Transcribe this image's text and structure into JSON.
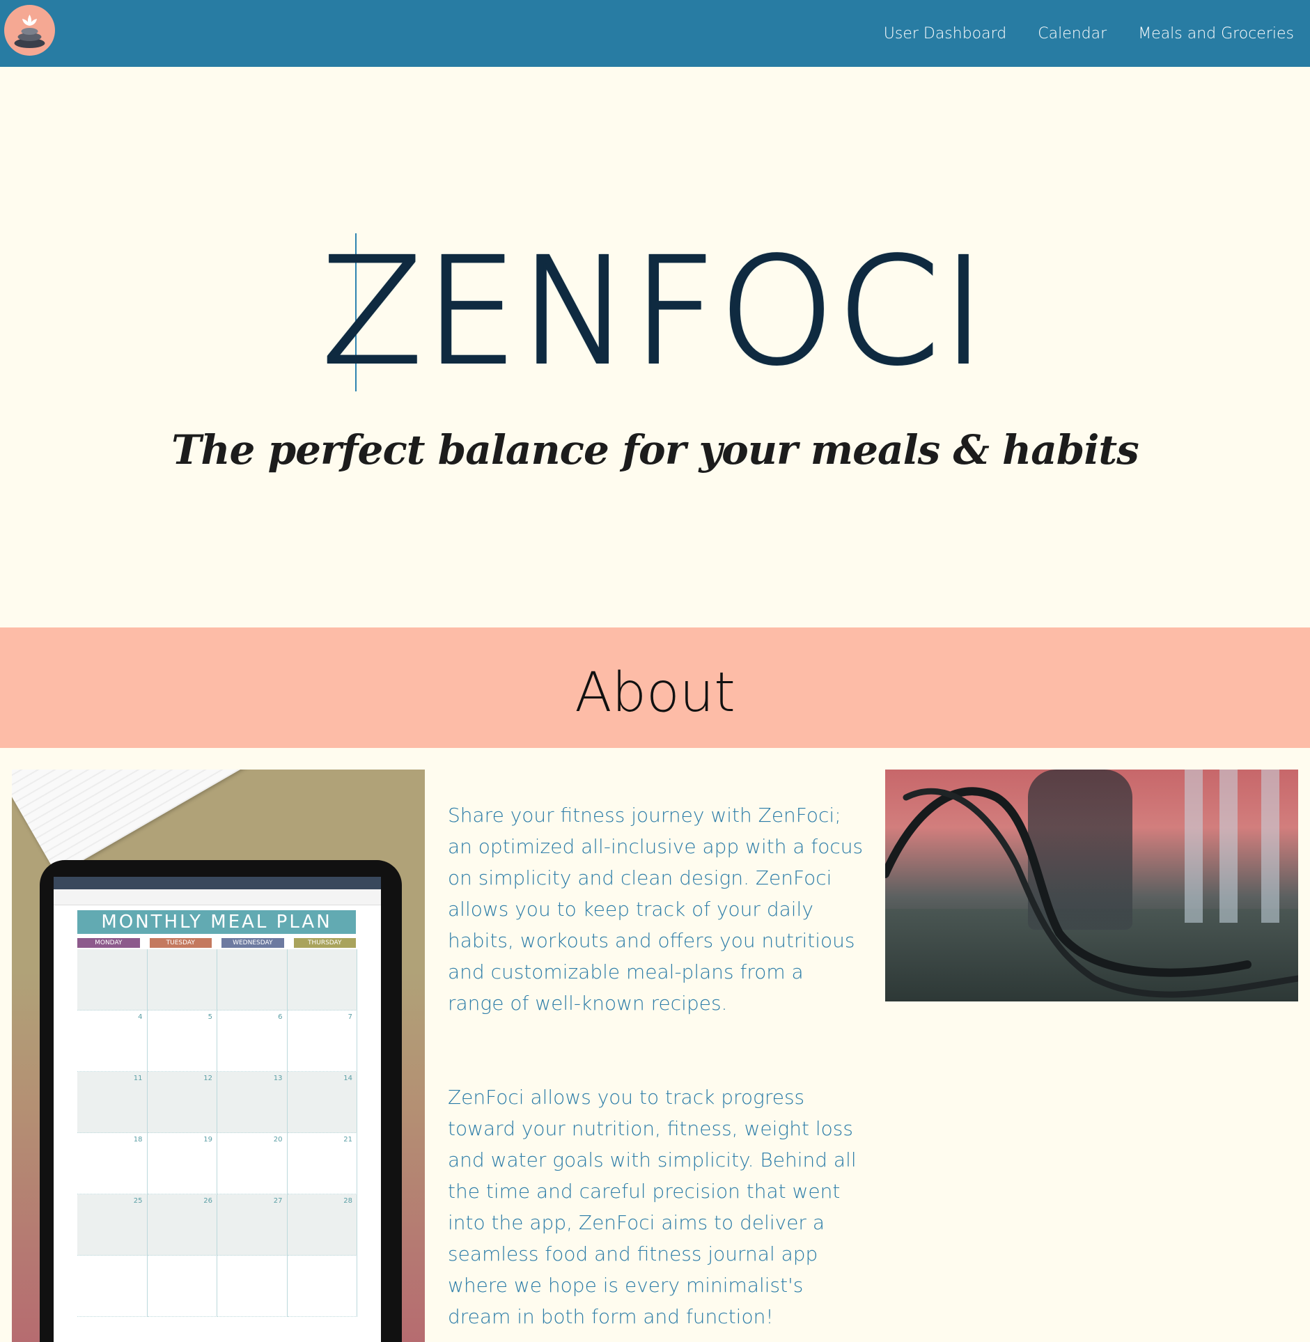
{
  "nav": {
    "logo": "lotus-stone-logo",
    "links": [
      "User Dashboard",
      "Calendar",
      "Meals and Groceries"
    ]
  },
  "hero": {
    "title": "ZENFOCI",
    "tagline": "The perfect balance for your meals & habits"
  },
  "about": {
    "heading": "About",
    "paragraph1": "Share your fitness journey with ZenFoci; an optimized all-inclusive app with a focus on simplicity and clean design. ZenFoci allows you to keep track of your daily habits, workouts and offers you nutritious and customizable meal-plans from a range of well-known recipes.",
    "paragraph2": "ZenFoci allows you to track progress toward your nutrition, fitness, weight loss and water goals with simplicity. Behind all the time and careful precision that went into the app, ZenFoci aims to deliver a seamless food and fitness journal app where we hope is every minimalist's dream in both form and function!"
  },
  "meal_plan_image": {
    "title": "MONTHLY MEAL PLAN",
    "days": [
      "MONDAY",
      "TUESDAY",
      "WEDNESDAY",
      "THURSDAY"
    ],
    "day_colors": [
      "#8d5a8c",
      "#c4795f",
      "#6d7aa0",
      "#a9a35c"
    ],
    "rows": [
      [
        "",
        "",
        "",
        ""
      ],
      [
        "4",
        "5",
        "6",
        "7"
      ],
      [
        "11",
        "12",
        "13",
        "14"
      ],
      [
        "18",
        "19",
        "20",
        "21"
      ],
      [
        "25",
        "26",
        "27",
        "28"
      ],
      [
        "",
        "",
        "",
        ""
      ]
    ]
  },
  "colors": {
    "nav": "#287ca3",
    "background": "#fffcef",
    "about_band": "#fdbca7",
    "text_blue": "#2a7ba7"
  }
}
